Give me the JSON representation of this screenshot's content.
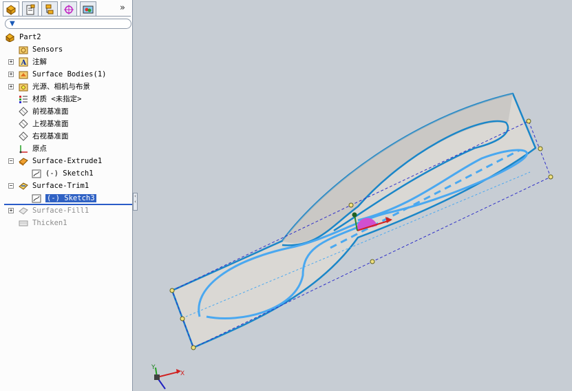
{
  "toolbar": {
    "tabs": [
      {
        "name": "feature-manager",
        "icon": "feature-tree-icon"
      },
      {
        "name": "property-manager",
        "icon": "property-manager-icon"
      },
      {
        "name": "configuration-manager",
        "icon": "configuration-icon"
      },
      {
        "name": "dimxpert-manager",
        "icon": "dimxpert-icon"
      },
      {
        "name": "display-manager",
        "icon": "display-manager-icon"
      }
    ],
    "more_label": "»"
  },
  "tree": {
    "root": "Part2",
    "items": [
      {
        "label": "Sensors",
        "icon": "sensors-icon",
        "expandable": false,
        "suppressed": false
      },
      {
        "label": "注解",
        "icon": "annotations-icon",
        "expandable": true,
        "suppressed": false
      },
      {
        "label": "Surface Bodies(1)",
        "icon": "surface-bodies-icon",
        "expandable": true,
        "suppressed": false
      },
      {
        "label": "光源、相机与布景",
        "icon": "lights-cameras-icon",
        "expandable": true,
        "suppressed": false
      },
      {
        "label": "材质 <未指定>",
        "icon": "material-icon",
        "expandable": false,
        "suppressed": false
      },
      {
        "label": "前视基准面",
        "icon": "plane-icon",
        "expandable": false,
        "suppressed": false
      },
      {
        "label": "上视基准面",
        "icon": "plane-icon",
        "expandable": false,
        "suppressed": false
      },
      {
        "label": "右视基准面",
        "icon": "plane-icon",
        "expandable": false,
        "suppressed": false
      },
      {
        "label": "原点",
        "icon": "origin-icon",
        "expandable": false,
        "suppressed": false
      },
      {
        "label": "Surface-Extrude1",
        "icon": "surface-extrude-icon",
        "expandable": true,
        "expanded": true,
        "suppressed": false
      },
      {
        "label": "(-) Sketch1",
        "icon": "sketch-icon",
        "child": true,
        "suppressed": false
      },
      {
        "label": "Surface-Trim1",
        "icon": "surface-trim-icon",
        "expandable": true,
        "expanded": true,
        "suppressed": false
      },
      {
        "label": "(-) Sketch3",
        "icon": "sketch-icon",
        "child": true,
        "selected": true,
        "suppressed": false
      },
      {
        "label": "Surface-Fill1",
        "icon": "surface-fill-icon",
        "expandable": true,
        "suppressed": true
      },
      {
        "label": "Thicken1",
        "icon": "thicken-icon",
        "expandable": false,
        "suppressed": true
      }
    ]
  },
  "viewport": {
    "triad": {
      "x_label": "X",
      "y_label": "Y"
    },
    "colors": {
      "background": "#c7cdd4",
      "surface": "#d9d7d3",
      "edge": "#1a86c8",
      "sketch": "#4aa8f0",
      "bbox": "#3030c8"
    }
  }
}
